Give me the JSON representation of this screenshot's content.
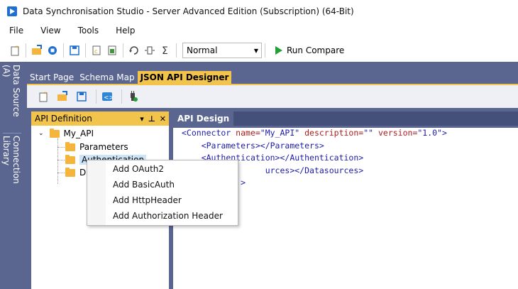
{
  "app": {
    "title": "Data Synchronisation Studio - Server Advanced Edition (Subscription) (64-Bit)"
  },
  "menu": [
    "File",
    "View",
    "Tools",
    "Help"
  ],
  "toolbar": {
    "mode_value": "Normal",
    "run_label": "Run Compare"
  },
  "side_tabs": {
    "data_source": "Data Source (A)",
    "connection_library": "Connection Library"
  },
  "doc_tabs": [
    "Start Page",
    "Schema Map",
    "JSON API Designer"
  ],
  "left_pane": {
    "title": "API Definition",
    "pin_glyph": "▾ ⊥ ✕",
    "tree": {
      "root": "My_API",
      "children": [
        "Parameters",
        "Authentication",
        "Datasources"
      ],
      "partial_label": "D"
    }
  },
  "right_pane": {
    "title": "API Design",
    "code": {
      "line1_open": "<Connector",
      "line1_attr1": " name=",
      "line1_val1": "\"My_API\"",
      "line1_attr2": " description=",
      "line1_val2": "\"\"",
      "line1_attr3": " version=",
      "line1_val3": "\"1.0\"",
      "line1_close": ">",
      "line2": "<Parameters></Parameters>",
      "line3": "<Authentication></Authentication>",
      "line4": "urces></Datasources>",
      "line5": ">"
    }
  },
  "context_menu": {
    "items": [
      "Add OAuth2",
      "Add BasicAuth",
      "Add HttpHeader",
      "Add Authorization Header"
    ]
  },
  "colors": {
    "accent_yellow": "#f3c44b",
    "dock_blue": "#5a6690",
    "run_green": "#22a033"
  }
}
